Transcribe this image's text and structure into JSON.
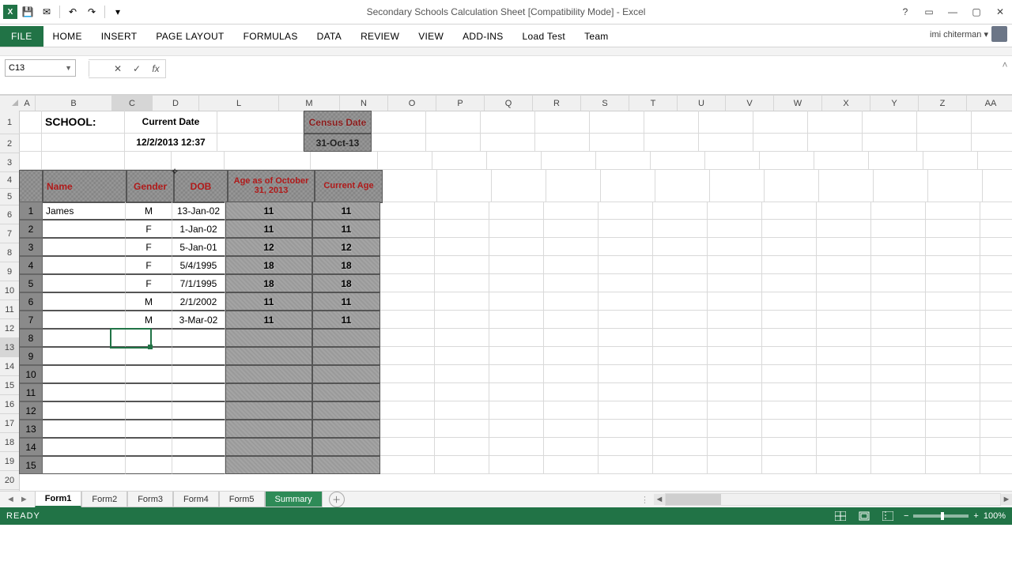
{
  "window": {
    "title": "Secondary Schools Calculation Sheet  [Compatibility Mode] - Excel",
    "user": "imi chiterman ▾"
  },
  "qat": {
    "save": "💾",
    "undo": "↶",
    "redo": "↷",
    "customize": "▾"
  },
  "ribbon": {
    "file": "FILE",
    "tabs": [
      "HOME",
      "INSERT",
      "PAGE LAYOUT",
      "FORMULAS",
      "DATA",
      "REVIEW",
      "VIEW",
      "ADD-INS",
      "Load Test",
      "Team"
    ]
  },
  "formula_bar": {
    "cell_ref": "C13",
    "cancel": "✕",
    "enter": "✓",
    "fx": "fx",
    "formula": ""
  },
  "columns": [
    {
      "id": "A",
      "cls": "cA"
    },
    {
      "id": "B",
      "cls": "cB"
    },
    {
      "id": "C",
      "cls": "cC",
      "sel": true
    },
    {
      "id": "D",
      "cls": "cD"
    },
    {
      "id": "L",
      "cls": "cL"
    },
    {
      "id": "M",
      "cls": "cM"
    },
    {
      "id": "N",
      "cls": "cN"
    },
    {
      "id": "O",
      "cls": "cO"
    },
    {
      "id": "P",
      "cls": "cP"
    },
    {
      "id": "Q",
      "cls": "cQ"
    },
    {
      "id": "R",
      "cls": "cR"
    },
    {
      "id": "S",
      "cls": "cS"
    },
    {
      "id": "T",
      "cls": "cT"
    },
    {
      "id": "U",
      "cls": "cU"
    },
    {
      "id": "V",
      "cls": "cV"
    },
    {
      "id": "W",
      "cls": "cW"
    },
    {
      "id": "X",
      "cls": "cX"
    },
    {
      "id": "Y",
      "cls": "cY"
    },
    {
      "id": "Z",
      "cls": "cZ"
    },
    {
      "id": "AA",
      "cls": "cAA"
    }
  ],
  "sheet": {
    "school_label": "SCHOOL:",
    "current_date_label": "Current Date",
    "current_date_value": "12/2/2013 12:37",
    "census_label": "Census Date",
    "census_value": "31-Oct-13",
    "headers": {
      "name": "Name",
      "gender": "Gender",
      "dob": "DOB",
      "age_as_of": "Age as of October 31, 2013",
      "current_age": "Current Age"
    },
    "rows": [
      {
        "idx": "1",
        "name": "James",
        "gender": "M",
        "dob": "13-Jan-02",
        "age1": "11",
        "age2": "11"
      },
      {
        "idx": "2",
        "name": "",
        "gender": "F",
        "dob": "1-Jan-02",
        "age1": "11",
        "age2": "11"
      },
      {
        "idx": "3",
        "name": "",
        "gender": "F",
        "dob": "5-Jan-01",
        "age1": "12",
        "age2": "12"
      },
      {
        "idx": "4",
        "name": "",
        "gender": "F",
        "dob": "5/4/1995",
        "age1": "18",
        "age2": "18"
      },
      {
        "idx": "5",
        "name": "",
        "gender": "F",
        "dob": "7/1/1995",
        "age1": "18",
        "age2": "18"
      },
      {
        "idx": "6",
        "name": "",
        "gender": "M",
        "dob": "2/1/2002",
        "age1": "11",
        "age2": "11"
      },
      {
        "idx": "7",
        "name": "",
        "gender": "M",
        "dob": "3-Mar-02",
        "age1": "11",
        "age2": "11"
      },
      {
        "idx": "8",
        "name": "",
        "gender": "",
        "dob": "",
        "age1": "",
        "age2": ""
      },
      {
        "idx": "9",
        "name": "",
        "gender": "",
        "dob": "",
        "age1": "",
        "age2": ""
      },
      {
        "idx": "10",
        "name": "",
        "gender": "",
        "dob": "",
        "age1": "",
        "age2": ""
      },
      {
        "idx": "11",
        "name": "",
        "gender": "",
        "dob": "",
        "age1": "",
        "age2": ""
      },
      {
        "idx": "12",
        "name": "",
        "gender": "",
        "dob": "",
        "age1": "",
        "age2": ""
      },
      {
        "idx": "13",
        "name": "",
        "gender": "",
        "dob": "",
        "age1": "",
        "age2": ""
      },
      {
        "idx": "14",
        "name": "",
        "gender": "",
        "dob": "",
        "age1": "",
        "age2": ""
      },
      {
        "idx": "15",
        "name": "",
        "gender": "",
        "dob": "",
        "age1": "",
        "age2": ""
      }
    ]
  },
  "sheet_tabs": [
    "Form1",
    "Form2",
    "Form3",
    "Form4",
    "Form5",
    "Summary"
  ],
  "active_sheet": "Form1",
  "status": {
    "ready": "READY",
    "zoom": "100%"
  }
}
